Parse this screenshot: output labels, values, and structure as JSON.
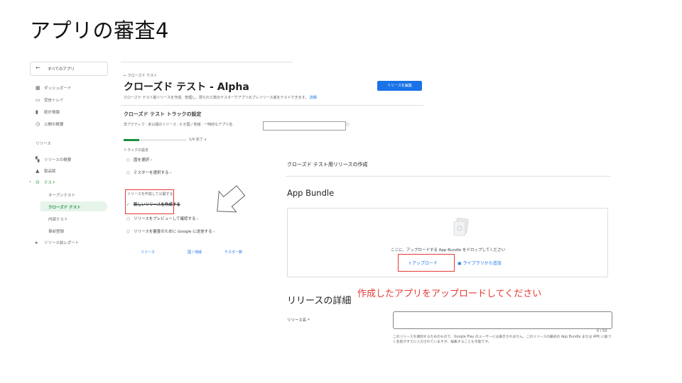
{
  "slide": {
    "title": "アプリの審査4"
  },
  "sidebar": {
    "back_label": "すべてのアプリ",
    "top_items": [
      {
        "label": "ダッシュボード",
        "icon": "dashboard-icon"
      },
      {
        "label": "受信トレイ",
        "icon": "inbox-icon"
      },
      {
        "label": "統計情報",
        "icon": "stats-icon"
      },
      {
        "label": "公開の概要",
        "icon": "publish-overview-icon"
      }
    ],
    "section": "リリース",
    "release_items": [
      {
        "label": "リリースの概要",
        "icon": "overview-icon"
      },
      {
        "label": "製品版",
        "icon": "production-icon"
      },
      {
        "label": "テスト",
        "icon": "play-icon"
      }
    ],
    "test_subitems": [
      "オープンテスト",
      "クローズド テスト",
      "内部テスト",
      "事前登録"
    ],
    "more_item": "リリース前レポート"
  },
  "console": {
    "breadcrumb": "← クローズド テスト",
    "heading": "クローズド テスト - Alpha",
    "subtitle": "クローズド テスト版リリースを作成、管理し、限られた数のテスターでアプリのプレリリース版をテストできます。",
    "subtitle_link": "詳細",
    "edit_button": "リリースを編集",
    "track_settings_title": "クローズド テスト トラックの設定",
    "status_line": "非アクティブ · 未公開のリリース : 0 か国 / 地域 · 一時的なアプリ名",
    "progress_value": 0.25,
    "progress_text": "1/4 完了 ∧",
    "steps_heading": "トラックの設定",
    "steps": [
      {
        "label": "国を選択 ›"
      },
      {
        "label": "テスターを選択する ›"
      }
    ],
    "release_steps_heading": "リリースを作成して公開する",
    "release_steps": [
      {
        "label": "新しいリリースを作成する",
        "done": true
      },
      {
        "label": "リリースをプレビューして確認する ›",
        "done": false
      },
      {
        "label": "リリースを審査のために Google に送信する ›",
        "done": false
      }
    ],
    "table_headers": [
      "リリース",
      "国 / 地域",
      "テスター数"
    ]
  },
  "panel": {
    "title": "クローズド テスト用リリースの作成",
    "app_bundle_heading": "App Bundle",
    "drop_text": "ここに、アップロードする App Bundle をドロップしてください",
    "upload_link": "アップロード",
    "library_link": "ライブラリから追加",
    "details_heading": "リリースの詳細",
    "release_name_label": "リリース名 *",
    "release_name_value": "",
    "counter": "0 / 50",
    "help_text": "このリリースを識別するためのもので、Google Play のユーザーには表示されません。このリリースの最初の App Bundle または APK に基づく名前がすでに入力されていますが、編集することも可能です。"
  },
  "annotation": {
    "message": "作成したアプリをアップロードしてください",
    "color": "#e53935"
  },
  "colors": {
    "accent": "#1a73e8",
    "success": "#1e8e3e",
    "highlight": "#e53935"
  }
}
